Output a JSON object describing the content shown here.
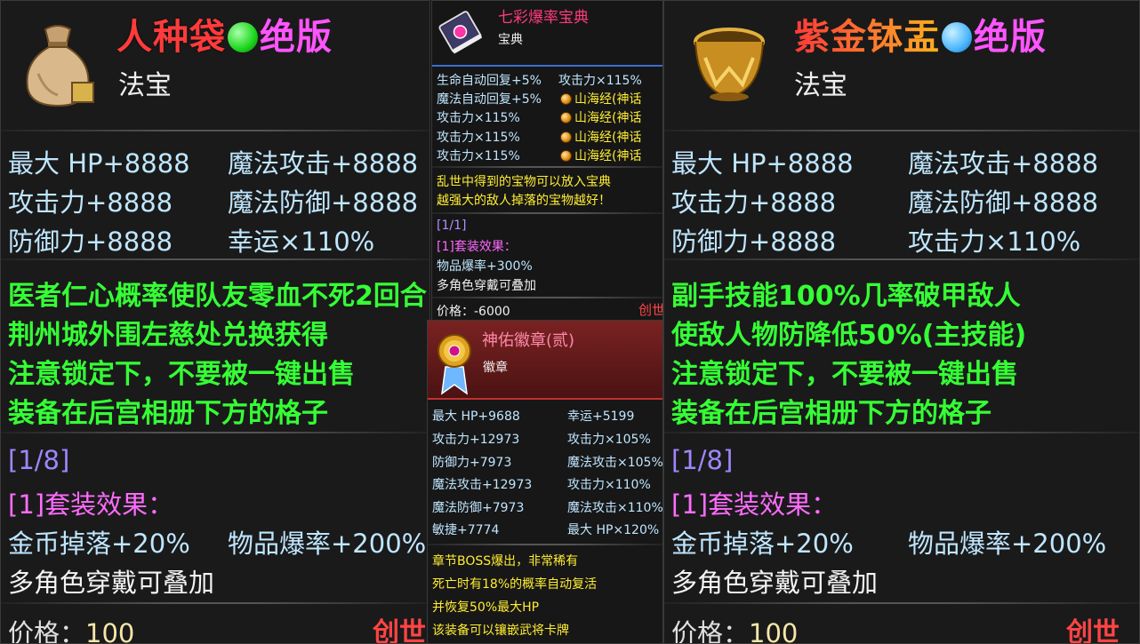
{
  "left_card": {
    "title": "人种袋",
    "title_suffix": "绝版",
    "subtitle": "法宝",
    "stats_left": [
      "最大 HP+8888",
      "攻击力+8888",
      "防御力+8888"
    ],
    "stats_right": [
      "魔法攻击+8888",
      "魔法防御+8888",
      "幸运×110%"
    ],
    "description": [
      "医者仁心概率使队友零血不死2回合",
      "荆州城外围左慈处兑换获得",
      "注意锁定下，不要被一键出售",
      "装备在后宫相册下方的格子"
    ],
    "set_count": "[1/8]",
    "set_effect_label": "[1]套装效果：",
    "set_bonus_1": "金币掉落+20%",
    "set_bonus_2": "物品爆率+200%",
    "stack_note": "多角色穿戴可叠加",
    "price_label": "价格：",
    "price_value": "100",
    "brand": "创世"
  },
  "top_mid_card": {
    "title": "七彩爆率宝典",
    "subtitle": "宝典",
    "rows": [
      {
        "left": "生命自动回复+5%",
        "right": "攻击力×115%",
        "coin": false
      },
      {
        "left": "魔法自动回复+5%",
        "right": "山海经(神话",
        "coin": true
      },
      {
        "left": "攻击力×115%",
        "right": "山海经(神话",
        "coin": true
      },
      {
        "left": "攻击力×115%",
        "right": "山海经(神话",
        "coin": true
      },
      {
        "left": "攻击力×115%",
        "right": "山海经(神话",
        "coin": true
      }
    ],
    "desc": [
      "乱世中得到的宝物可以放入宝典",
      "越强大的敌人掉落的宝物越好！"
    ],
    "set_count": "[1/1]",
    "set_effect_label": "[1]套装效果：",
    "set_bonus": "物品爆率+300%",
    "stack_note": "多角色穿戴可叠加",
    "price_label": "价格：",
    "price_value": "-6000",
    "brand": "创世"
  },
  "bottom_mid_card": {
    "title": "神佑徽章(贰)",
    "subtitle": "徽章",
    "stats_left": [
      "最大 HP+9688",
      "攻击力+12973",
      "防御力+7973",
      "魔法攻击+12973",
      "魔法防御+7973",
      "敏捷+7774"
    ],
    "stats_right": [
      "幸运+5199",
      "攻击力×105%",
      "魔法攻击×105%",
      "攻击力×110%",
      "魔法攻击×110%",
      "最大 HP×120%"
    ],
    "desc": [
      "章节BOSS爆出，非常稀有",
      "死亡时有18%的概率自动复活",
      "并恢复50%最大HP",
      "该装备可以镶嵌武将卡牌"
    ]
  },
  "right_card": {
    "title": "紫金钵盂",
    "title_suffix": "绝版",
    "subtitle": "法宝",
    "stats_left": [
      "最大 HP+8888",
      "攻击力+8888",
      "防御力+8888"
    ],
    "stats_right": [
      "魔法攻击+8888",
      "魔法防御+8888",
      "攻击力×110%"
    ],
    "description": [
      "副手技能100%几率破甲敌人",
      "使敌人物防降低50%(主技能)",
      "注意锁定下，不要被一键出售",
      "装备在后宫相册下方的格子"
    ],
    "set_count": "[1/8]",
    "set_effect_label": "[1]套装效果：",
    "set_bonus_1": "金币掉落+20%",
    "set_bonus_2": "物品爆率+200%",
    "stack_note": "多角色穿戴可叠加",
    "price_label": "价格：",
    "price_value": "100",
    "brand": "创世"
  },
  "colors": {
    "left_title": "#ff3b3b",
    "left_suffix": "#ff55ff",
    "right_title": "#ff3b3b",
    "right_title_gold": "#ffb020",
    "right_suffix": "#ff55ff",
    "brand": "#ff4444",
    "brand_alt": "#ff55ff",
    "green_text": "#35ff35",
    "stat_text": "#bfe6ff"
  },
  "icons": [
    "cloth-bag-icon",
    "golden-bowl-icon",
    "jeweled-book-icon",
    "medal-badge-icon",
    "green-orb-icon",
    "gold-coin-icon"
  ]
}
